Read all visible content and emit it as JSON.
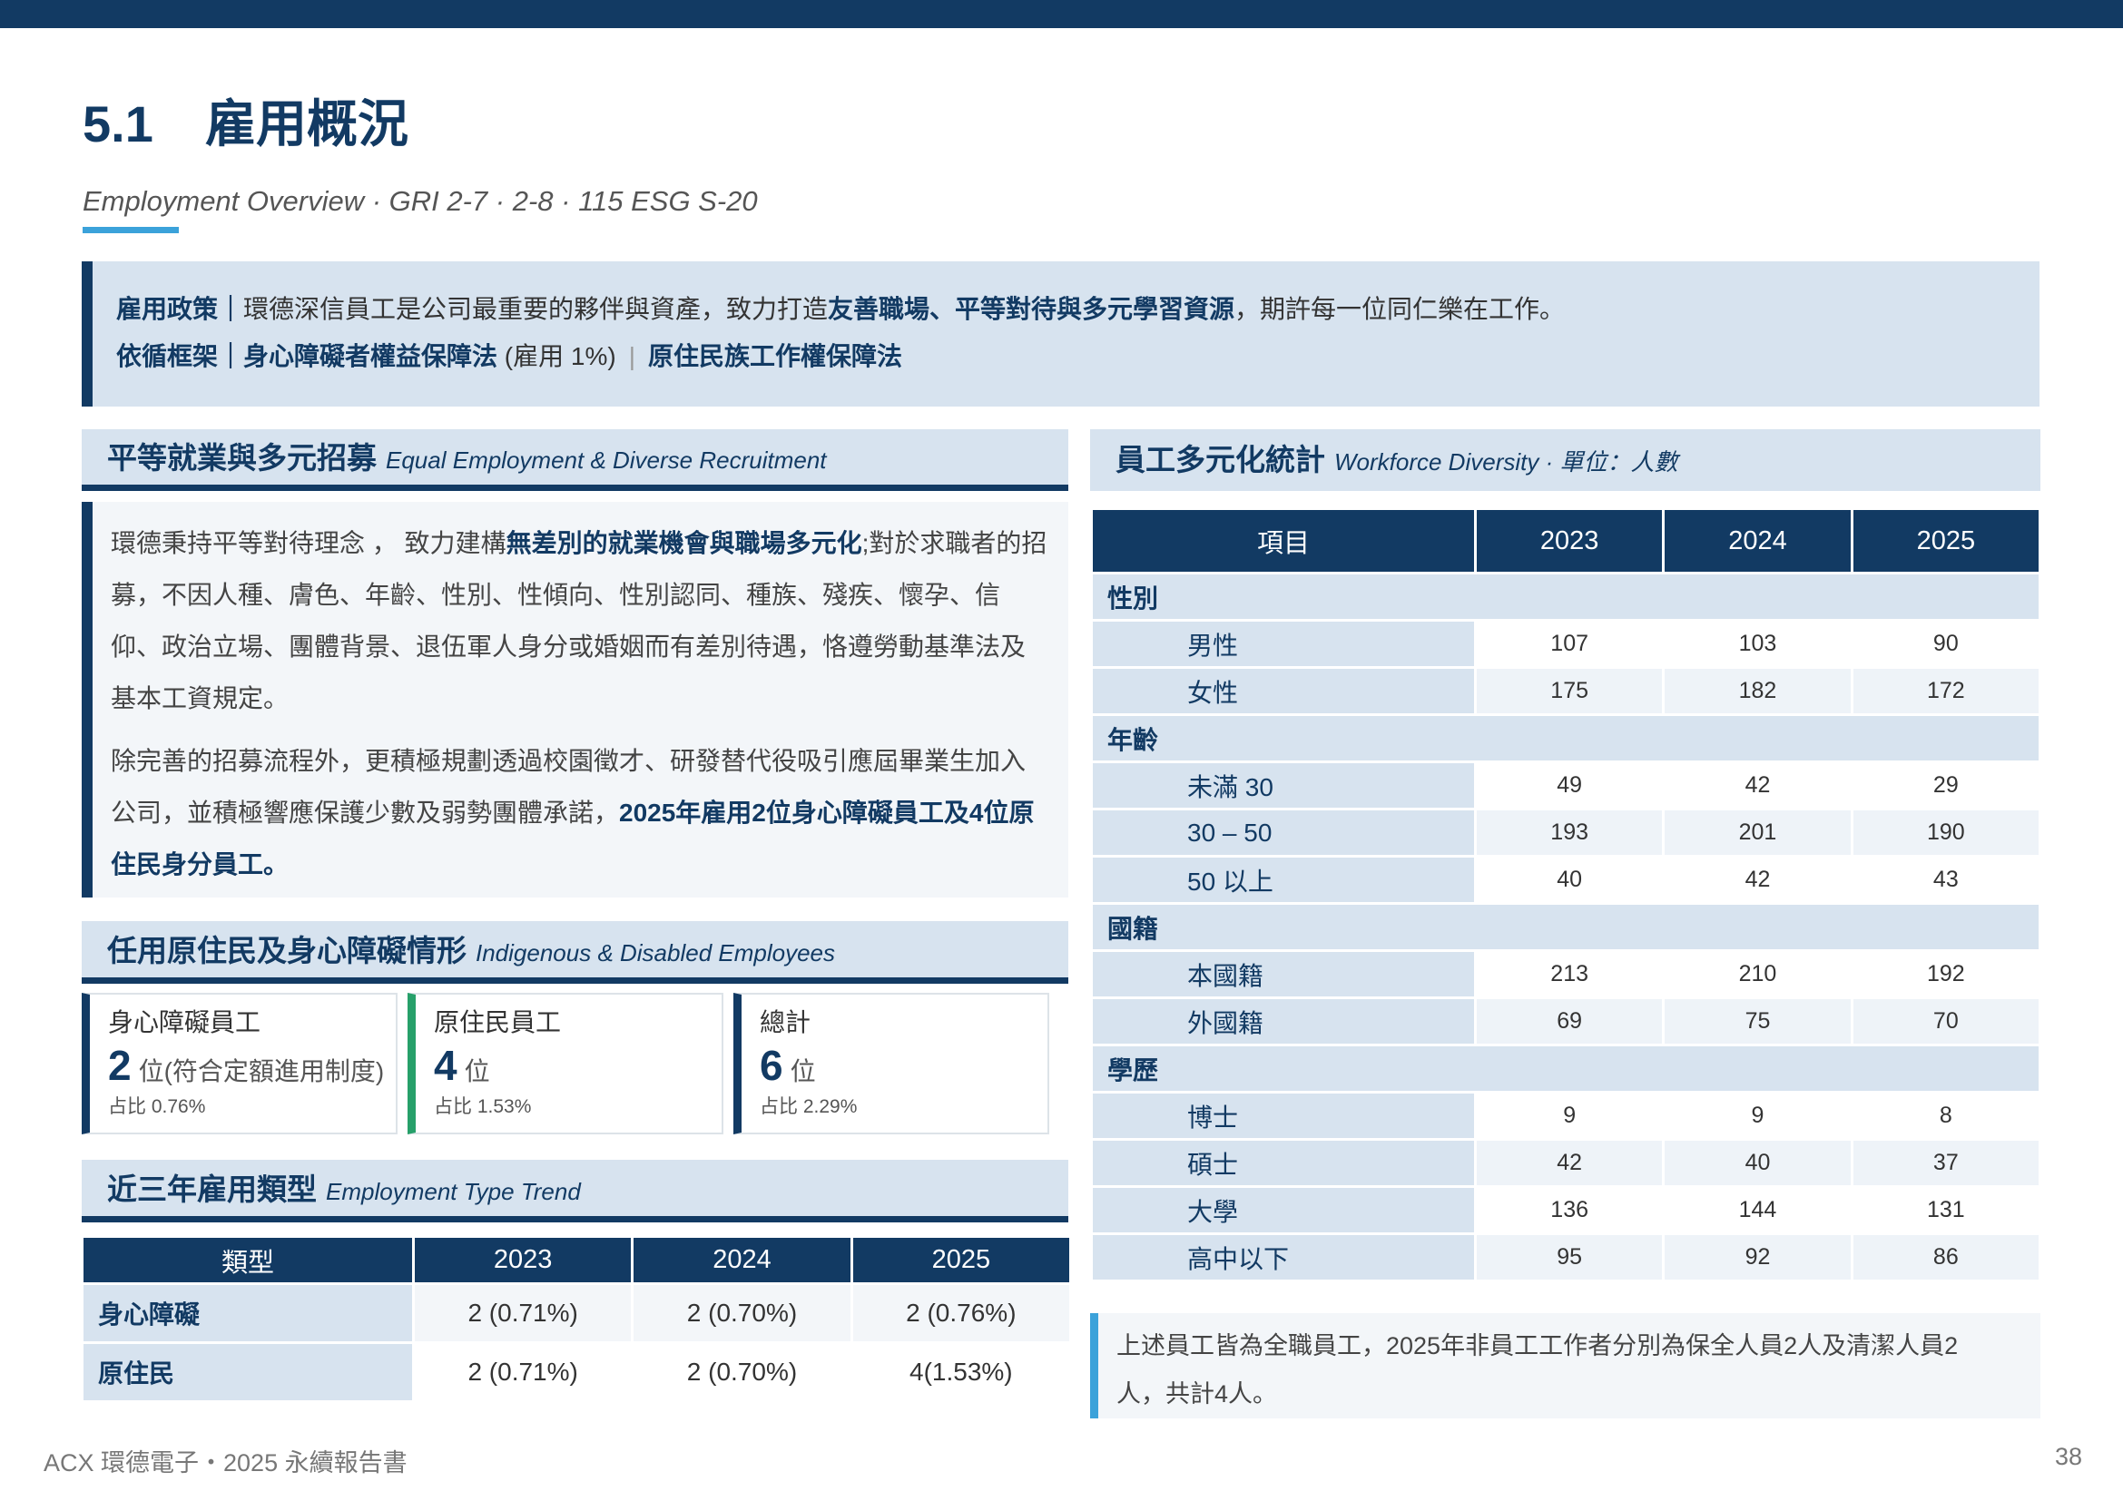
{
  "header": {
    "section_number": "5.1",
    "section_title": "雇用概況",
    "subtitle": "Employment Overview · GRI 2-7 · 2-8 · 115 ESG S-20"
  },
  "policy": {
    "line1_label": "雇用政策｜",
    "line1_text_a": "環德深信員工是公司最重要的夥伴與資產，致力打造",
    "line1_bold": "友善職場、平等對待與多元學習資源",
    "line1_text_b": "，期許每一位同仁樂在工作。",
    "line2_label": "依循框架｜",
    "line2_law1": "身心障礙者權益保障法",
    "line2_law1_note": " (雇用 1%)",
    "line2_sep": "|",
    "line2_law2": "原住民族工作權保障法"
  },
  "equal_section": {
    "title_cn": "平等就業與多元招募",
    "title_en": "Equal Employment & Diverse Recruitment",
    "p1_a": "環德秉持平等對待理念 ， 致力建構",
    "p1_bold": "無差別的就業機會與職場多元化",
    "p1_b": ";對於求職者的招募，不因人種、膚色、年齡、性別、性傾向、性別認同、種族、殘疾、懷孕、信仰、政治立場、團體背景、退伍軍人身分或婚姻而有差別待遇，恪遵勞動基準法及基本工資規定。",
    "p2_a": "除完善的招募流程外，更積極規劃透過校園徵才、研發替代役吸引應屆畢業生加入公司，並積極響應保護少數及弱勢團體承諾，",
    "p2_bold": "2025年雇用2位身心障礙員工及4位原住民身分員工。"
  },
  "indigenous_section": {
    "title_cn": "任用原住民及身心障礙情形",
    "title_en": "Indigenous & Disabled Employees",
    "cards": [
      {
        "label": "身心障礙員工",
        "value": "2",
        "unit": "位(符合定額進用制度)",
        "ratio": "占比 0.76%"
      },
      {
        "label": "原住民員工",
        "value": "4",
        "unit": "位",
        "ratio": "占比 1.53%"
      },
      {
        "label": "總計",
        "value": "6",
        "unit": "位",
        "ratio": "占比 2.29%"
      }
    ]
  },
  "type_section": {
    "title_cn": "近三年雇用類型",
    "title_en": "Employment Type Trend",
    "headers": [
      "類型",
      "2023",
      "2024",
      "2025"
    ],
    "rows": [
      [
        "身心障礙",
        "2 (0.71%)",
        "2 (0.70%)",
        "2 (0.76%)"
      ],
      [
        "原住民",
        "2 (0.71%)",
        "2 (0.70%)",
        "4(1.53%)"
      ]
    ]
  },
  "diversity_section": {
    "title_cn": "員工多元化統計",
    "title_en": "Workforce Diversity · 單位：人數",
    "headers": [
      "項目",
      "2023",
      "2024",
      "2025"
    ],
    "groups": [
      {
        "name": "性別",
        "rows": [
          [
            "男性",
            "107",
            "103",
            "90"
          ],
          [
            "女性",
            "175",
            "182",
            "172"
          ]
        ]
      },
      {
        "name": "年齡",
        "rows": [
          [
            "未滿 30",
            "49",
            "42",
            "29"
          ],
          [
            "30 – 50",
            "193",
            "201",
            "190"
          ],
          [
            "50 以上",
            "40",
            "42",
            "43"
          ]
        ]
      },
      {
        "name": "國籍",
        "rows": [
          [
            "本國籍",
            "213",
            "210",
            "192"
          ],
          [
            "外國籍",
            "69",
            "75",
            "70"
          ]
        ]
      },
      {
        "name": "學歷",
        "rows": [
          [
            "博士",
            "9",
            "9",
            "8"
          ],
          [
            "碩士",
            "42",
            "40",
            "37"
          ],
          [
            "大學",
            "136",
            "144",
            "131"
          ],
          [
            "高中以下",
            "95",
            "92",
            "86"
          ]
        ]
      }
    ],
    "note": "上述員工皆為全職員工，2025年非員工工作者分別為保全人員2人及清潔人員2人，共計4人。"
  },
  "footer": {
    "left": "ACX 環德電子・2025 永續報告書",
    "page": "38"
  }
}
